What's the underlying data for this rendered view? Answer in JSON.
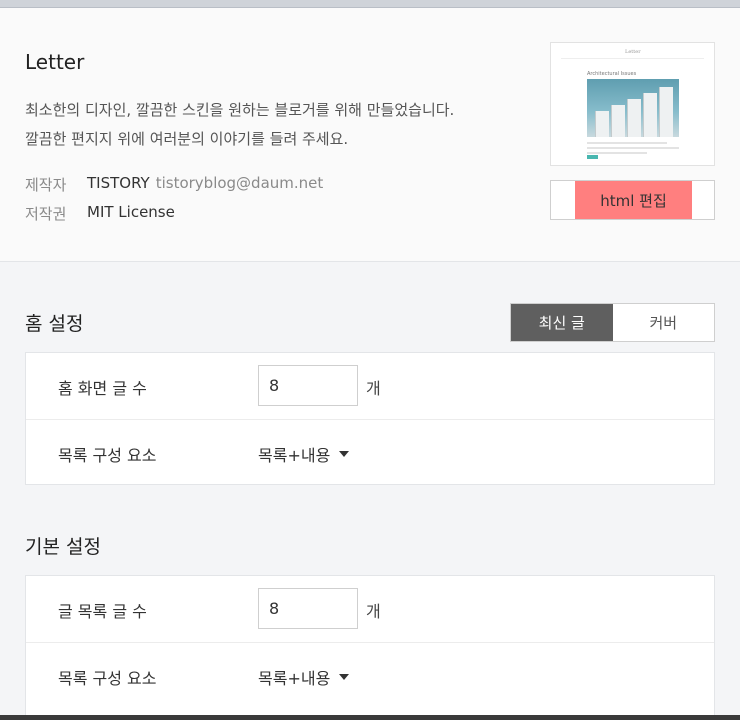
{
  "skin": {
    "name": "Letter",
    "description_line1": "최소한의 디자인, 깔끔한 스킨을 원하는 블로거를 위해 만들었습니다.",
    "description_line2": "깔끔한 편지지 위에 여러분의 이야기를 들려 주세요.",
    "maker_label": "제작자",
    "maker_name": "TISTORY",
    "maker_email": "tistoryblog@daum.net",
    "license_label": "저작권",
    "license_value": "MIT License",
    "edit_button_label": "html 편집",
    "highlight_color": "#ff7f7f"
  },
  "home_settings": {
    "title": "홈 설정",
    "toggle": {
      "latest": "최신 글",
      "cover": "커버",
      "active": "latest"
    },
    "post_count_label": "홈 화면 글 수",
    "post_count_value": "8",
    "post_count_unit": "개",
    "list_component_label": "목록 구성 요소",
    "list_component_value": "목록+내용"
  },
  "basic_settings": {
    "title": "기본 설정",
    "post_count_label": "글 목록 글 수",
    "post_count_value": "8",
    "post_count_unit": "개",
    "list_component_label": "목록 구성 요소",
    "list_component_value": "목록+내용"
  }
}
